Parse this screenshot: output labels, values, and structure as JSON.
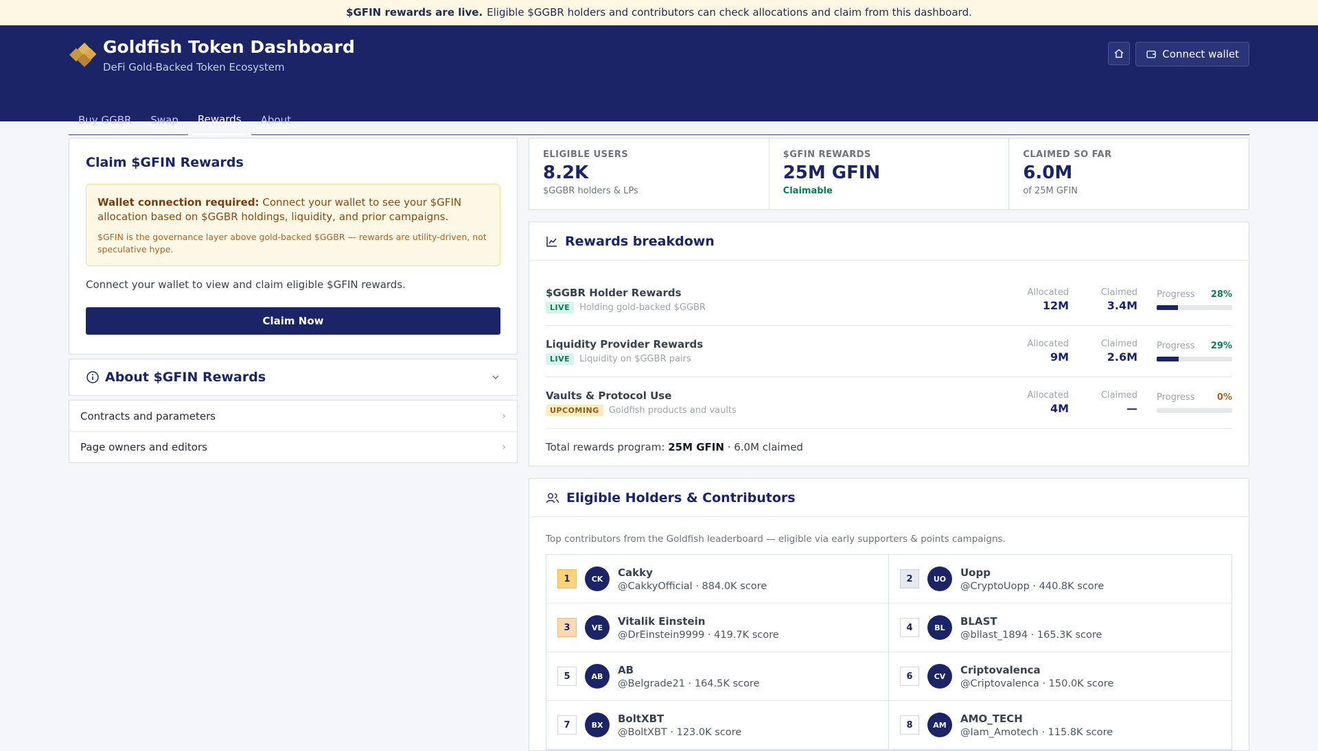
{
  "banner": {
    "bold": "$GFIN rewards are live.",
    "text": "Eligible $GGBR holders and contributors can check allocations and claim from this dashboard."
  },
  "header": {
    "title": "Goldfish Token Dashboard",
    "subtitle": "DeFi Gold-Backed Token Ecosystem",
    "home_icon": "home-icon",
    "wallet_label": "Connect wallet",
    "tabs": [
      {
        "label": "Buy GGBR",
        "active": false
      },
      {
        "label": "Swap",
        "active": false
      },
      {
        "label": "Rewards",
        "active": true
      },
      {
        "label": "About",
        "active": false
      }
    ]
  },
  "claim": {
    "title": "Claim $GFIN Rewards",
    "warn_bold": "Wallet connection required:",
    "warn_text": "Connect your wallet to see your $GFIN allocation based on $GGBR holdings, liquidity, and prior campaigns.",
    "warn_sub": "$GFIN is the governance layer above gold-backed $GGBR — rewards are utility-driven, not speculative hype.",
    "desc": "Connect your wallet to view and claim eligible $GFIN rewards.",
    "button": "Claim Now"
  },
  "about": {
    "title": "About $GFIN Rewards",
    "links": [
      "Contracts and parameters",
      "Page owners and editors"
    ]
  },
  "stats": [
    {
      "label": "ELIGIBLE USERS",
      "value": "8.2K",
      "sub": "$GGBR holders & LPs"
    },
    {
      "label": "$GFIN REWARDS",
      "value": "25M GFIN",
      "sub": "Claimable"
    },
    {
      "label": "CLAIMED SO FAR",
      "value": "6.0M",
      "sub": "of 25M GFIN"
    }
  ],
  "breakdown": {
    "title": "Rewards breakdown",
    "allocated_label": "Allocated",
    "claimed_label": "Claimed",
    "progress_label": "Progress",
    "rows": [
      {
        "name": "$GGBR Holder Rewards",
        "status": "LIVE",
        "desc": "Holding gold-backed $GGBR",
        "allocated": "12M",
        "claimed": "3.4M",
        "pct": "28%",
        "progress": 0.28
      },
      {
        "name": "Liquidity Provider Rewards",
        "status": "LIVE",
        "desc": "Liquidity on $GGBR pairs",
        "allocated": "9M",
        "claimed": "2.6M",
        "pct": "29%",
        "progress": 0.29
      },
      {
        "name": "Vaults & Protocol Use",
        "status": "UPCOMING",
        "desc": "Goldfish products and vaults",
        "allocated": "4M",
        "claimed": "—",
        "pct": "0%",
        "progress": 0
      }
    ],
    "total_prefix": "Total rewards program:",
    "total_bold": "25M GFIN",
    "total_suffix": "· 6.0M claimed"
  },
  "holders": {
    "title": "Eligible Holders & Contributors",
    "desc": "Top contributors from the Goldfish leaderboard — eligible via early supporters & points campaigns.",
    "items": [
      {
        "rank": "1",
        "initials": "CK",
        "name": "Cakky",
        "sub": "@CakkyOfficial · 884.0K score"
      },
      {
        "rank": "2",
        "initials": "UO",
        "name": "Uopp",
        "sub": "@CryptoUopp · 440.8K score"
      },
      {
        "rank": "3",
        "initials": "VE",
        "name": "Vitalik Einstein",
        "sub": "@DrEinstein9999 · 419.7K score"
      },
      {
        "rank": "4",
        "initials": "BL",
        "name": "BLAST",
        "sub": "@bllast_1894 · 165.3K score"
      },
      {
        "rank": "5",
        "initials": "AB",
        "name": "AB",
        "sub": "@Belgrade21 · 164.5K score"
      },
      {
        "rank": "6",
        "initials": "CV",
        "name": "Criptovalenca",
        "sub": "@Criptovalenca · 150.0K score"
      },
      {
        "rank": "7",
        "initials": "BX",
        "name": "BoltXBT",
        "sub": "@BoltXBT · 123.0K score"
      },
      {
        "rank": "8",
        "initials": "AM",
        "name": "AMO_TECH",
        "sub": "@Iam_Amotech · 115.8K score"
      }
    ]
  },
  "colors": {
    "brand": "#1b2466",
    "accent_gold": "#c9973f",
    "live_green": "#0f7a5a"
  }
}
